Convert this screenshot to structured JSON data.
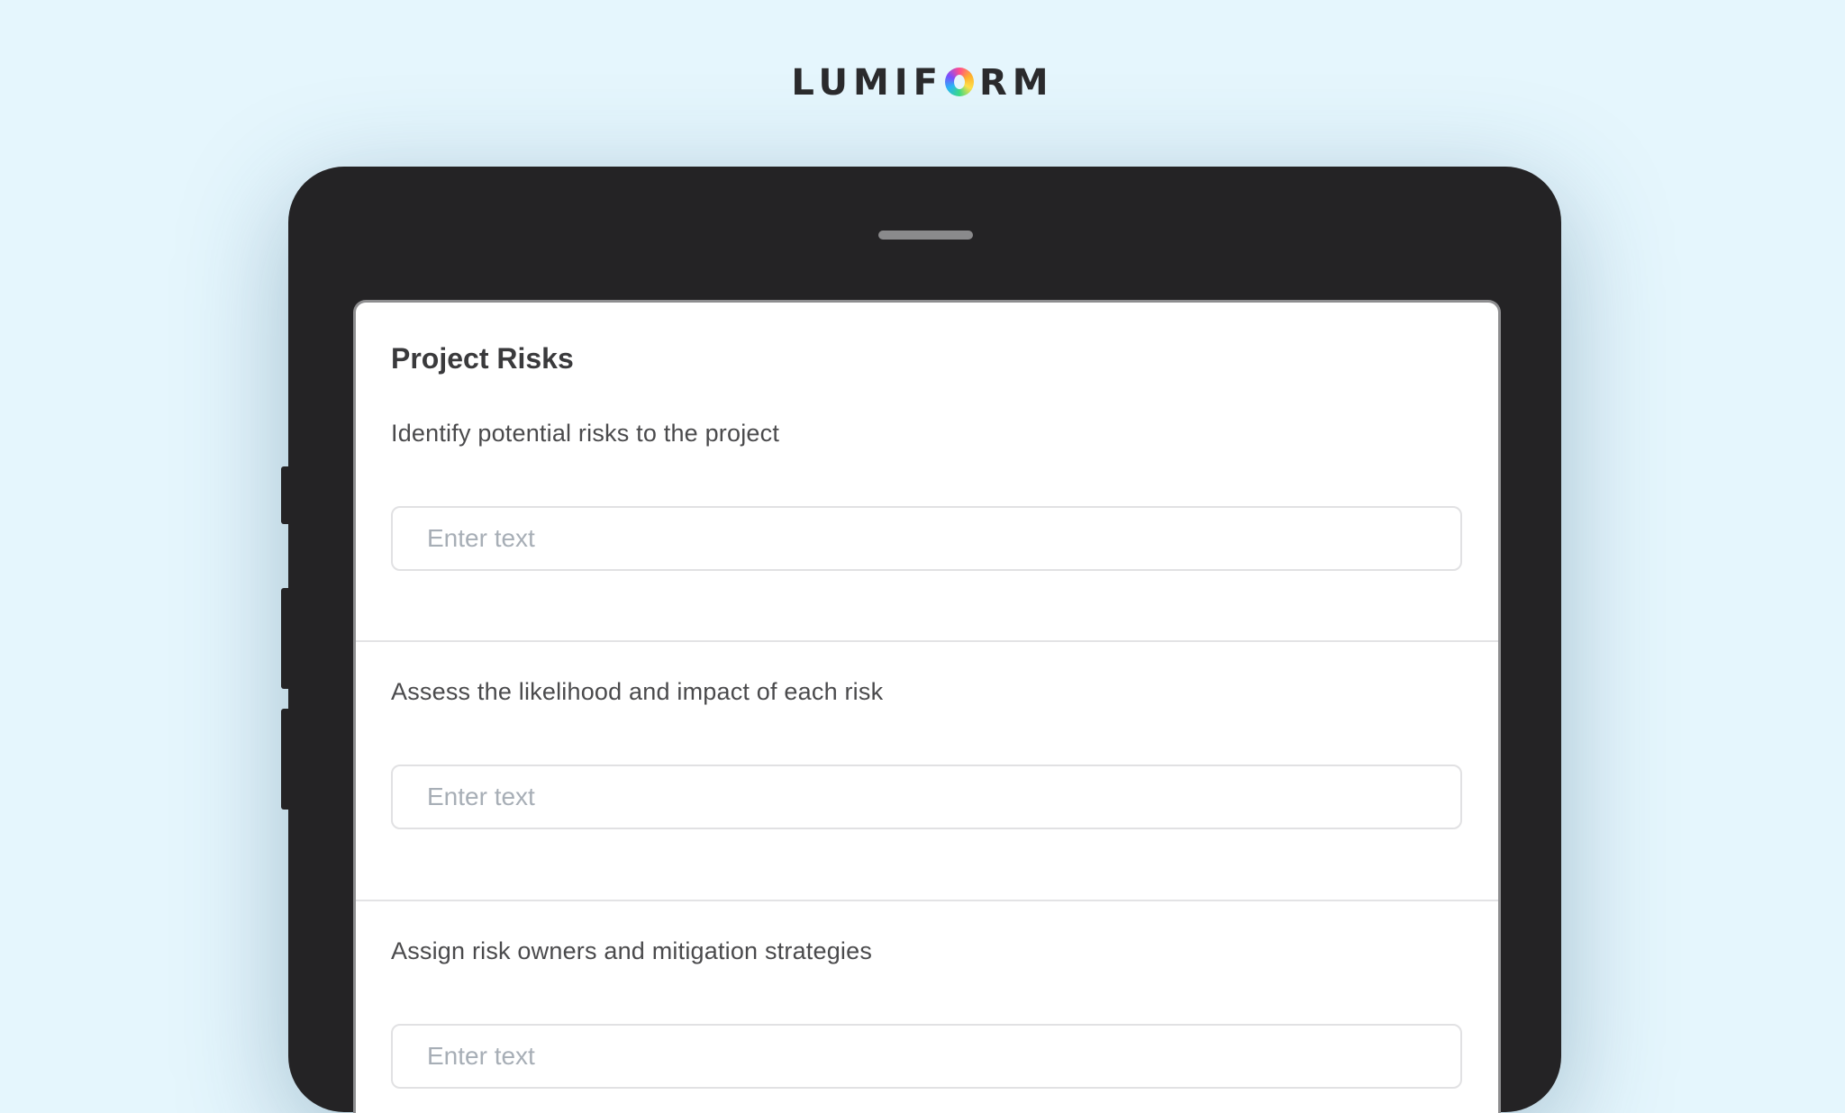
{
  "brand": {
    "logo_before": "LUMIF",
    "logo_after": "RM"
  },
  "form": {
    "title": "Project Risks",
    "questions": [
      {
        "label": "Identify potential risks to the project",
        "placeholder": "Enter text",
        "value": ""
      },
      {
        "label": "Assess the likelihood and impact of each risk",
        "placeholder": "Enter text",
        "value": ""
      },
      {
        "label": "Assign risk owners and mitigation strategies",
        "placeholder": "Enter text",
        "value": ""
      }
    ]
  },
  "colors": {
    "background": "#e5f6fd",
    "device": "#242325",
    "placeholder": "#a7aeb6"
  }
}
